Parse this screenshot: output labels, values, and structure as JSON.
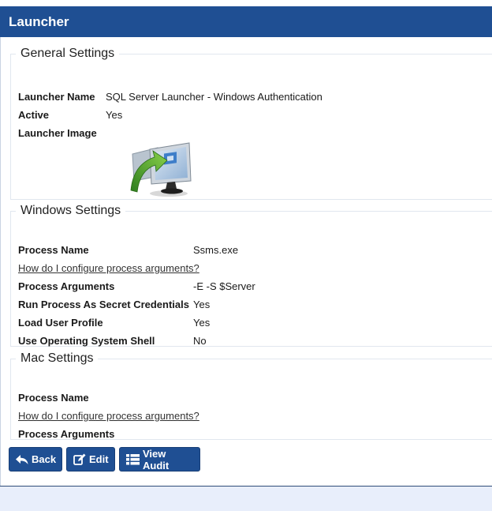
{
  "header": {
    "title": "Launcher"
  },
  "general": {
    "legend": "General Settings",
    "launcher_name_label": "Launcher Name",
    "launcher_name_value": "SQL Server Launcher - Windows Authentication",
    "active_label": "Active",
    "active_value": "Yes",
    "launcher_image_label": "Launcher Image",
    "image_icon": "monitor-with-green-arrow-icon"
  },
  "windows": {
    "legend": "Windows Settings",
    "process_name_label": "Process Name",
    "process_name_value": "Ssms.exe",
    "help_link": "How do I configure process arguments?",
    "process_args_label": "Process Arguments",
    "process_args_value": "-E -S $Server",
    "run_as_label": "Run Process As Secret Credentials",
    "run_as_value": "Yes",
    "load_profile_label": "Load User Profile",
    "load_profile_value": "Yes",
    "os_shell_label": "Use Operating System Shell",
    "os_shell_value": "No"
  },
  "mac": {
    "legend": "Mac Settings",
    "process_name_label": "Process Name",
    "help_link": "How do I configure process arguments?",
    "process_args_label": "Process Arguments"
  },
  "buttons": {
    "back": "Back",
    "edit": "Edit",
    "view_audit": "View Audit"
  },
  "colors": {
    "header": "#1f4f93",
    "button": "#1f4f93",
    "footer": "#e8eefb"
  }
}
